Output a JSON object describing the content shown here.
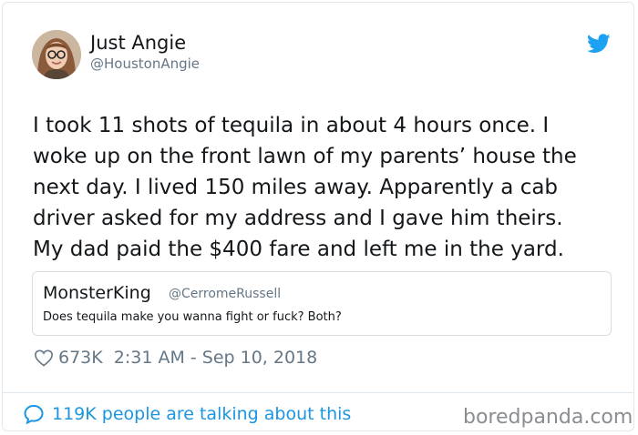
{
  "author": {
    "name": "Just Angie",
    "handle": "@HoustonAngie"
  },
  "tweet": {
    "lines": [
      "I took 11 shots of tequila in about 4 hours once. I",
      "woke up on the front lawn of my parents’ house the",
      "next day. I lived 150 miles away. Apparently a cab",
      "driver asked for my address and I gave him theirs.",
      "My dad paid the $400 fare and left me in the yard."
    ]
  },
  "quoted": {
    "name": "MonsterKing",
    "handle": "@CerromeRussell",
    "text": "Does tequila make you wanna fight or fuck? Both?"
  },
  "meta": {
    "likes": "673K",
    "timestamp": "2:31 AM - Sep 10, 2018"
  },
  "footer": {
    "talking": "119K people are talking about this",
    "credit": "boredpanda.com"
  },
  "icons": {
    "bird": "twitter-bird-icon",
    "heart": "heart-icon",
    "reply": "speech-bubble-icon"
  },
  "colors": {
    "twitter_blue": "#1da1f2",
    "link_blue": "#1b95e0",
    "muted": "#657786"
  }
}
